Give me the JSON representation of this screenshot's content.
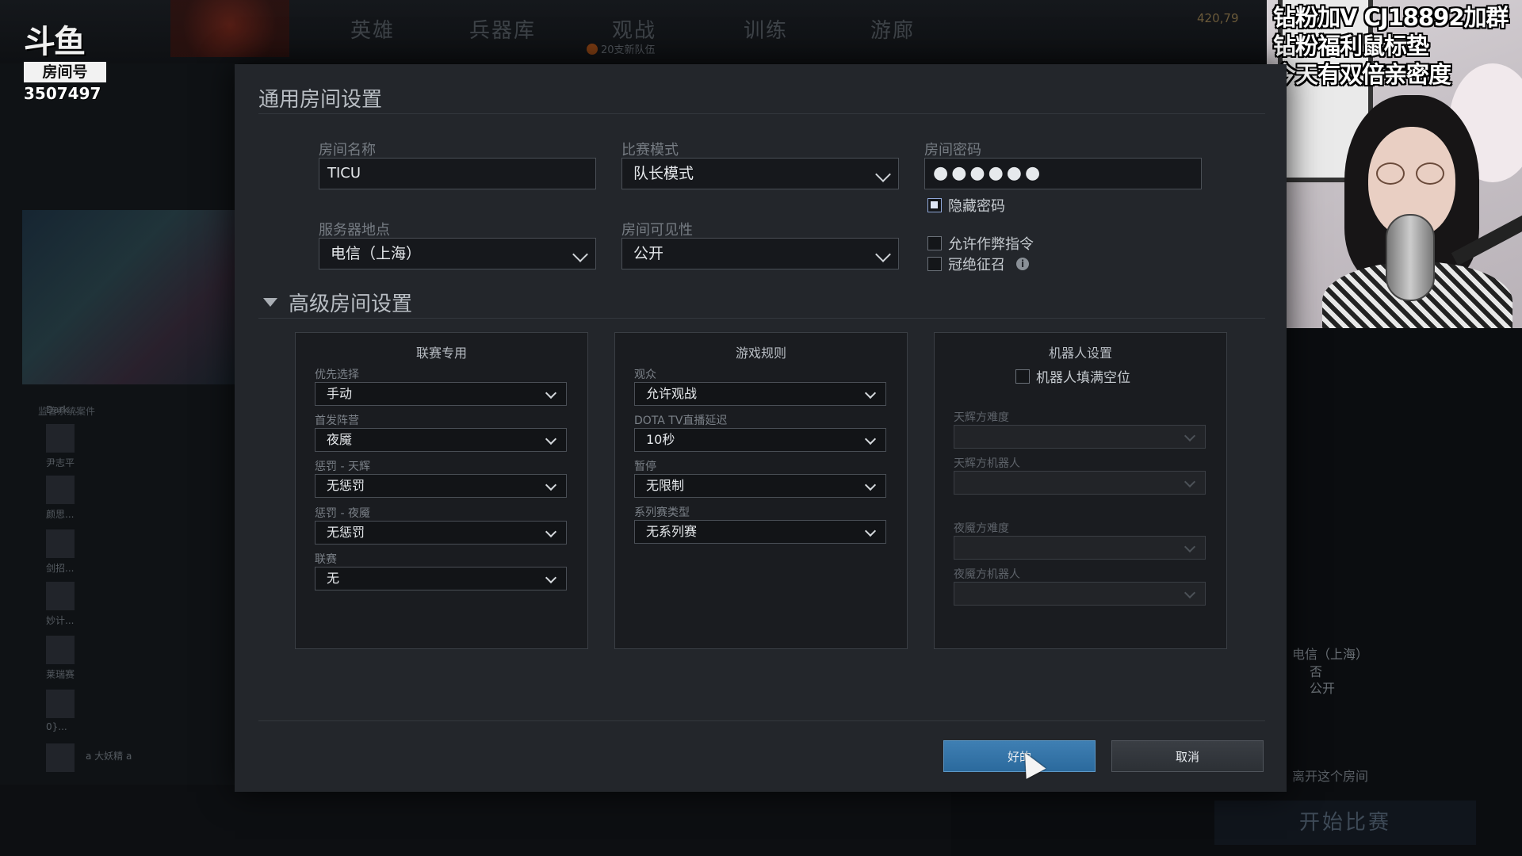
{
  "topnav": {
    "items": [
      "英雄",
      "兵器库",
      "观战",
      "训练",
      "游廊"
    ],
    "sub_badge": "20支新队伍",
    "currency": "420,79"
  },
  "douyu": {
    "logo_text": "斗鱼",
    "room_tag": "房间号",
    "room_number": "3507497"
  },
  "stream_overlay": {
    "lines": [
      "钻粉加V CJ18892加群",
      "钻粉福利鼠标垫",
      "今天有双倍亲密度"
    ]
  },
  "background": {
    "section_head": "监管系统案件",
    "list_names": [
      "Dark...",
      "尹志平",
      "颜思...",
      "剑招...",
      "妙计...",
      "莱瑞赛",
      "0}...",
      "a 大妖精 a"
    ],
    "summary": [
      "电信（上海）",
      "否",
      "公开"
    ],
    "leave_room": "离开这个房间",
    "start_match": "开始比赛"
  },
  "dialog": {
    "title": "通用房间设置",
    "room_name": {
      "label": "房间名称",
      "value": "TICU"
    },
    "game_mode": {
      "label": "比赛模式",
      "value": "队长模式"
    },
    "password": {
      "label": "房间密码",
      "value": "●●●●●●"
    },
    "hide_password": {
      "label": "隐藏密码",
      "checked": true
    },
    "server": {
      "label": "服务器地点",
      "value": "电信（上海）"
    },
    "visibility": {
      "label": "房间可见性",
      "value": "公开"
    },
    "allow_cheats": {
      "label": "允许作弊指令",
      "checked": false
    },
    "overcharge": {
      "label": "冠绝征召",
      "checked": false
    },
    "advanced_title": "高级房间设置",
    "panels": {
      "league": {
        "title": "联赛专用",
        "fields": [
          {
            "label": "优先选择",
            "value": "手动"
          },
          {
            "label": "首发阵营",
            "value": "夜魇"
          },
          {
            "label": "惩罚 - 天辉",
            "value": "无惩罚"
          },
          {
            "label": "惩罚 - 夜魇",
            "value": "无惩罚"
          },
          {
            "label": "联赛",
            "value": "无"
          }
        ]
      },
      "rules": {
        "title": "游戏规则",
        "fields": [
          {
            "label": "观众",
            "value": "允许观战"
          },
          {
            "label": "DOTA TV直播延迟",
            "value": "10秒"
          },
          {
            "label": "暂停",
            "value": "无限制"
          },
          {
            "label": "系列赛类型",
            "value": "无系列赛"
          }
        ]
      },
      "bots": {
        "title": "机器人设置",
        "fill_label": "机器人填满空位",
        "fields": [
          {
            "label": "天辉方难度",
            "value": ""
          },
          {
            "label": "天辉方机器人",
            "value": ""
          },
          {
            "label": "夜魇方难度",
            "value": ""
          },
          {
            "label": "夜魇方机器人",
            "value": ""
          }
        ]
      }
    },
    "ok_label": "好的",
    "cancel_label": "取消"
  }
}
